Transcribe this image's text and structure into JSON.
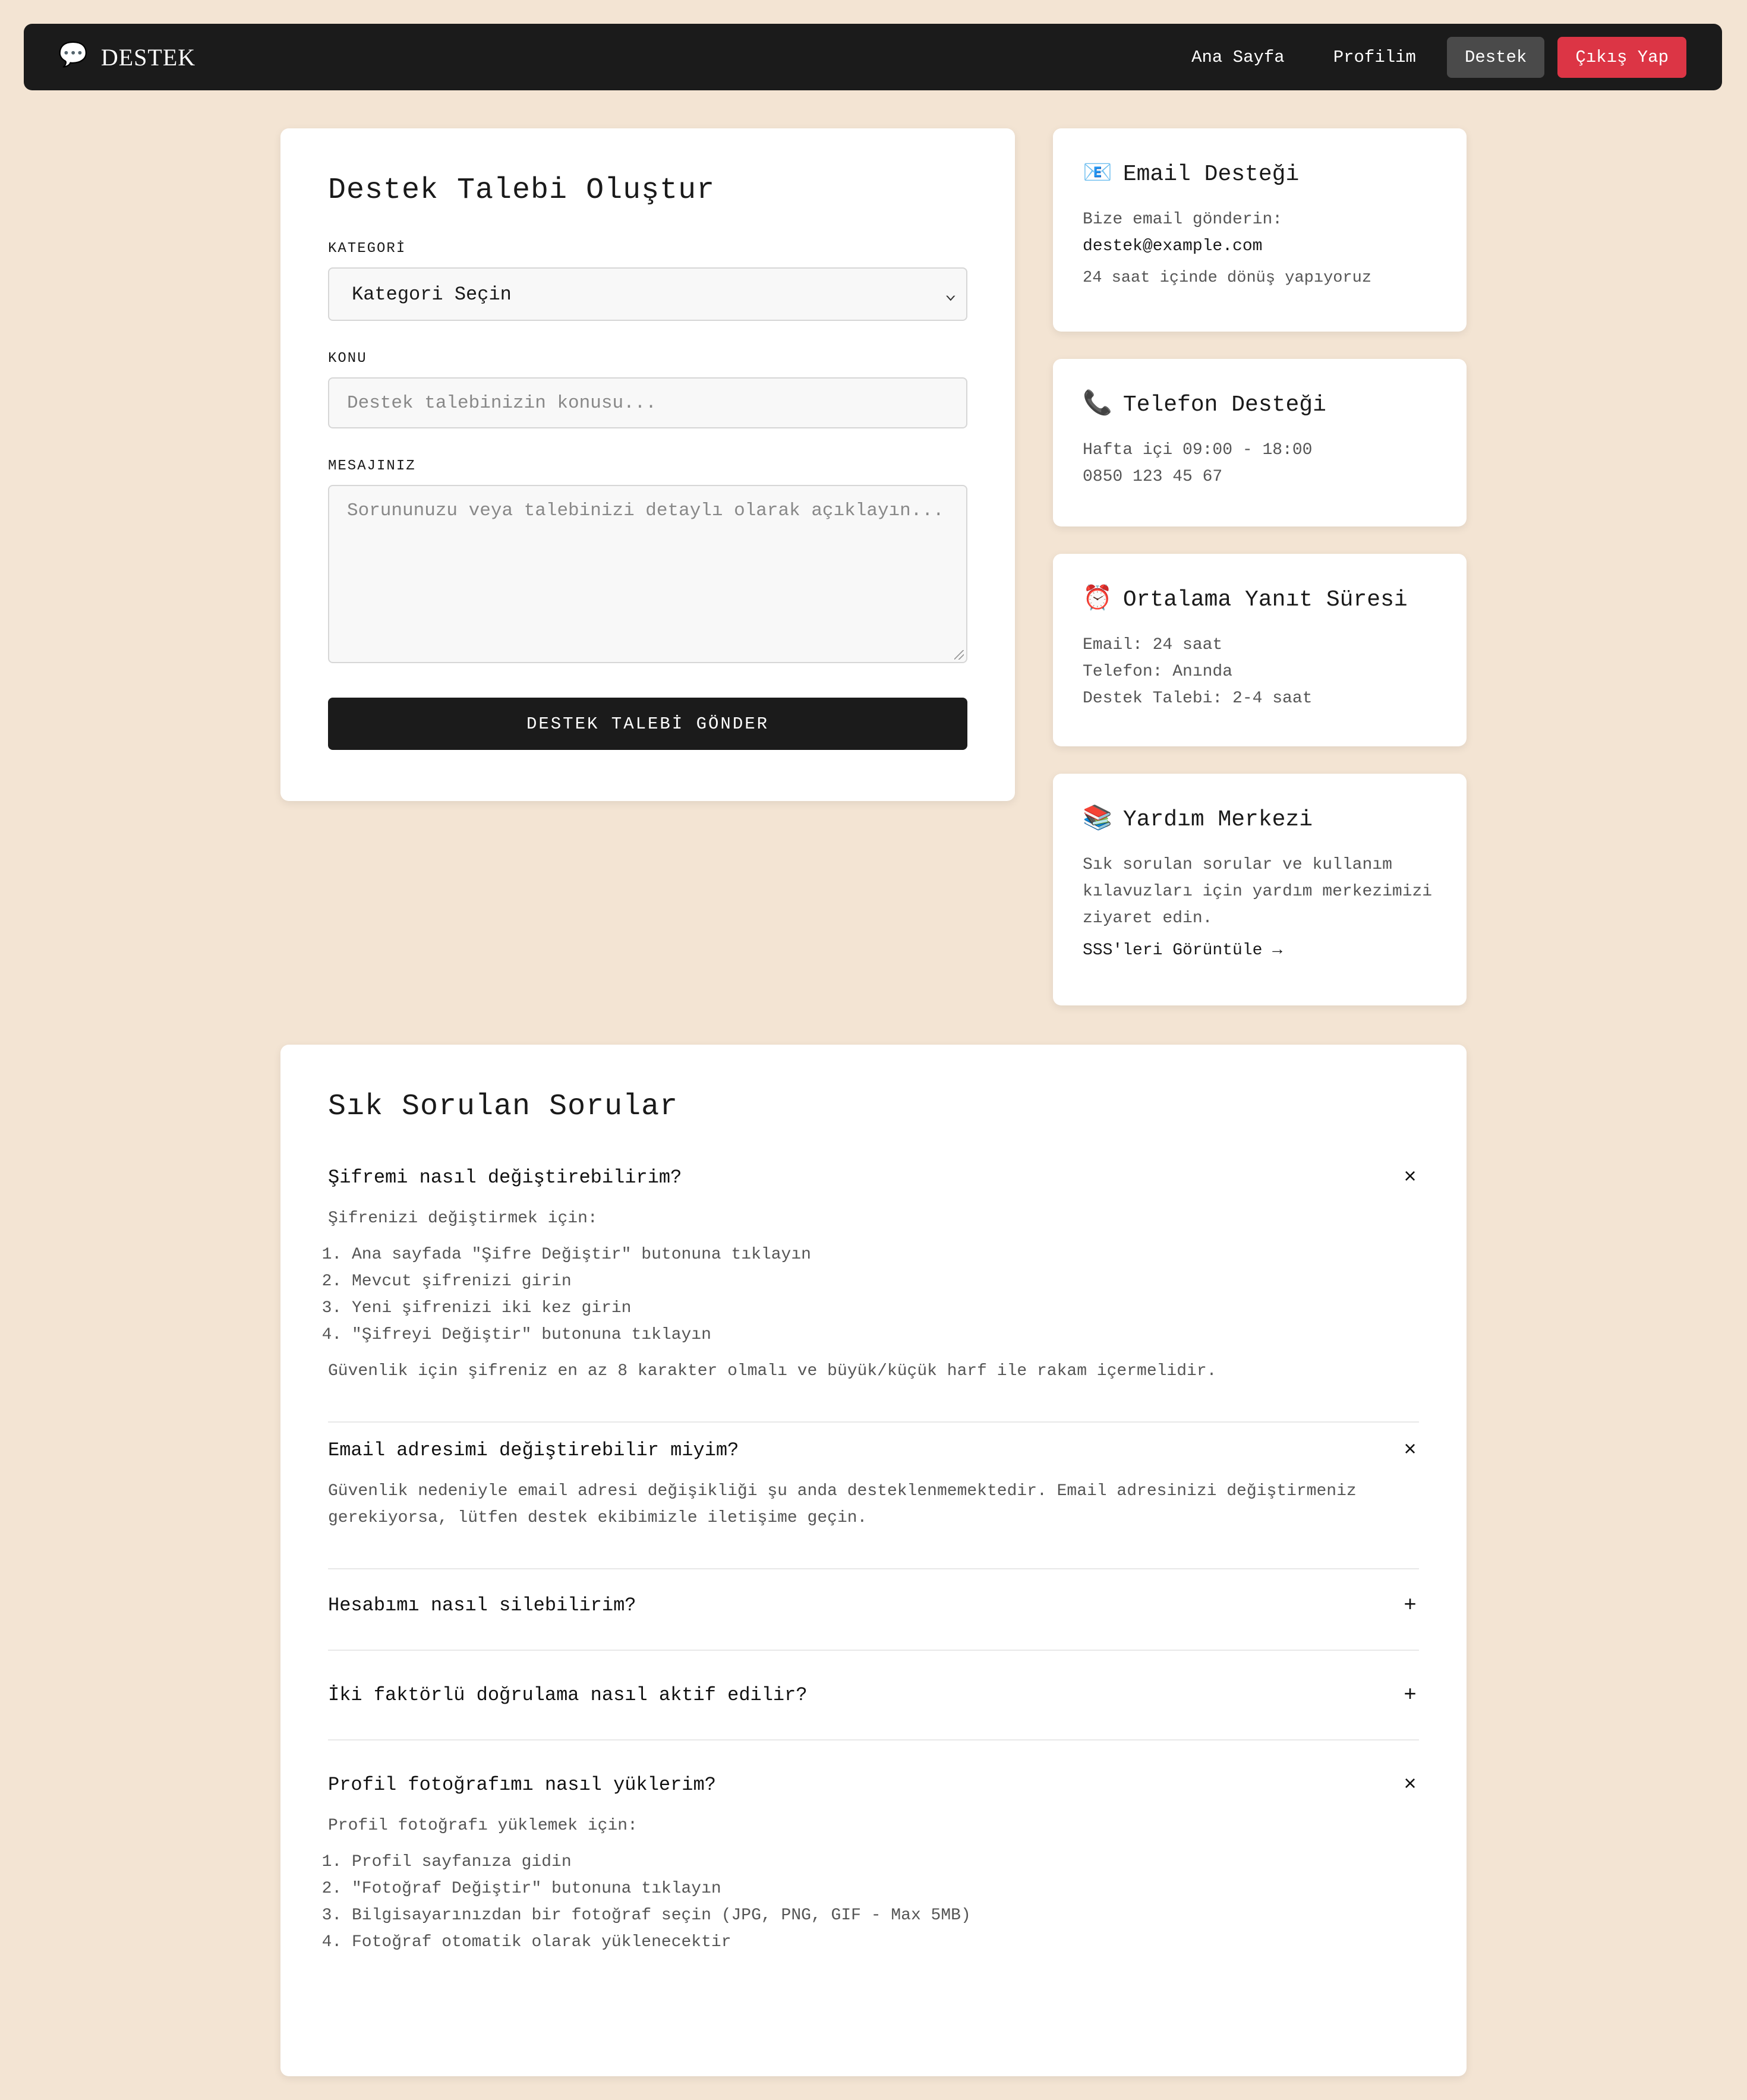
{
  "navbar": {
    "brand_icon": "💬",
    "brand": "DESTEK",
    "links": [
      "Ana Sayfa",
      "Profilim",
      "Destek",
      "Çıkış Yap"
    ]
  },
  "form": {
    "title": "Destek Talebi Oluştur",
    "category_label": "KATEGORİ",
    "category_value": "Kategori Seçin",
    "subject_label": "KONU",
    "subject_placeholder": "Destek talebinizin konusu...",
    "message_label": "MESAJINIZ",
    "message_placeholder": "Sorununuzu veya talebinizi detaylı olarak açıklayın...",
    "submit": "DESTEK TALEBİ GÖNDER"
  },
  "email_card": {
    "icon": "📧",
    "title": "Email Desteği",
    "line1": "Bize email gönderin:",
    "email": "destek@example.com",
    "note": "24 saat içinde dönüş yapıyoruz"
  },
  "phone_card": {
    "icon": "📞",
    "title": "Telefon Desteği",
    "hours": "Hafta içi 09:00 - 18:00",
    "number": "0850 123 45 67"
  },
  "response_card": {
    "icon": "⏰",
    "title": "Ortalama Yanıt Süresi",
    "lines": [
      "Email: 24 saat",
      "Telefon: Anında",
      "Destek Talebi: 2-4 saat"
    ]
  },
  "help_card": {
    "icon": "📚",
    "title": "Yardım Merkezi",
    "text": "Sık sorulan sorular ve kullanım kılavuzları için yardım merkezimizi ziyaret edin.",
    "link": "SSS'leri Görüntüle →"
  },
  "faq": {
    "title": "Sık Sorulan Sorular",
    "items": [
      {
        "question": "Şifremi nasıl değiştirebilirim?",
        "toggle": "×",
        "intro": "Şifrenizi değiştirmek için:",
        "steps": [
          "Ana sayfada \"Şifre Değiştir\" butonuna tıklayın",
          "Mevcut şifrenizi girin",
          "Yeni şifrenizi iki kez girin",
          "\"Şifreyi Değiştir\" butonuna tıklayın"
        ],
        "outro": "Güvenlik için şifreniz en az 8 karakter olmalı ve büyük/küçük harf ile rakam içermelidir."
      },
      {
        "question": "Email adresimi değiştirebilir miyim?",
        "toggle": "×",
        "answer": "Güvenlik nedeniyle email adresi değişikliği şu anda desteklenmemektedir. Email adresinizi değiştirmeniz gerekiyorsa, lütfen destek ekibimizle iletişime geçin."
      },
      {
        "question": "Hesabımı nasıl silebilirim?",
        "toggle": "+"
      },
      {
        "question": "İki faktörlü doğrulama nasıl aktif edilir?",
        "toggle": "+"
      },
      {
        "question": "Profil fotoğrafımı nasıl yüklerim?",
        "toggle": "×",
        "intro": "Profil fotoğrafı yüklemek için:",
        "steps": [
          "Profil sayfanıza gidin",
          "\"Fotoğraf Değiştir\" butonuna tıklayın",
          "Bilgisayarınızdan bir fotoğraf seçin (JPG, PNG, GIF - Max 5MB)",
          "Fotoğraf otomatik olarak yüklenecektir"
        ]
      }
    ]
  }
}
